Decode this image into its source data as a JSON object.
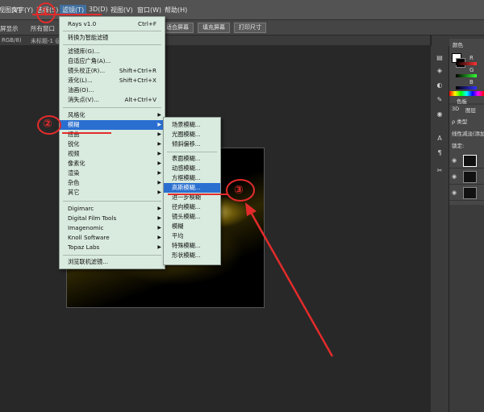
{
  "menubar": {
    "items": [
      "视图(V)",
      "文字(Y)",
      "选择(S)",
      "滤镜(T)",
      "3D(D)",
      "视图(V)",
      "窗口(W)",
      "帮助(H)"
    ]
  },
  "optbar": {
    "left_text": "屏显示",
    "left_text2": "所有窗口",
    "btn1": "适合屏幕",
    "btn2": "填充屏幕",
    "btn3": "打印尺寸"
  },
  "tabbar": {
    "tab1": "RGB/8)",
    "tab2": "未标题-1 @"
  },
  "filter_menu": {
    "top_items": [
      {
        "label": "Rays v1.0",
        "shortcut": "Ctrl+F"
      },
      {
        "label": "转换为智能滤镜",
        "shortcut": ""
      }
    ],
    "mid_items": [
      {
        "label": "滤镜库(G)...",
        "shortcut": ""
      },
      {
        "label": "自适应广角(A)...",
        "shortcut": ""
      },
      {
        "label": "镜头校正(R)...",
        "shortcut": "Shift+Ctrl+R"
      },
      {
        "label": "液化(L)...",
        "shortcut": "Shift+Ctrl+X"
      },
      {
        "label": "油画(O)...",
        "shortcut": ""
      },
      {
        "label": "消失点(V)...",
        "shortcut": "Alt+Ctrl+V"
      }
    ],
    "sub_items": [
      "风格化",
      "模糊",
      "扭曲",
      "锐化",
      "视频",
      "像素化",
      "渲染",
      "杂色",
      "其它"
    ],
    "plugins": [
      "Digimarc",
      "Digital Film Tools",
      "Imagenomic",
      "Knoll Software",
      "Topaz Labs"
    ],
    "browse": "浏览联机滤镜..."
  },
  "blur_menu": {
    "group1": [
      "场景模糊...",
      "光圈模糊...",
      "倾斜偏移..."
    ],
    "group2": [
      "表面模糊...",
      "动感模糊...",
      "方框模糊...",
      "高斯模糊...",
      "进一步模糊",
      "径向模糊...",
      "镜头模糊...",
      "模糊",
      "平均",
      "特殊模糊...",
      "形状模糊..."
    ]
  },
  "right_panel": {
    "color_tab": "颜色",
    "swatch_tab": "色板",
    "r": "R",
    "g": "G",
    "b": "B",
    "tab_3d": "3D",
    "layers_tab": "图层",
    "kind": "ρ 类型",
    "blend": "线性减淡(添加)",
    "lock": "锁定:"
  },
  "annotations": {
    "one": "①",
    "two": "②",
    "three": "③"
  }
}
